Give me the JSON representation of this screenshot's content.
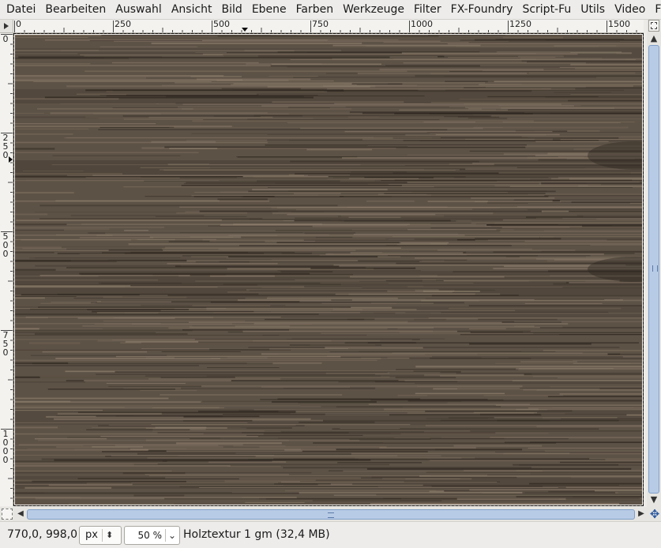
{
  "menu": {
    "items": [
      {
        "label": "Datei"
      },
      {
        "label": "Bearbeiten"
      },
      {
        "label": "Auswahl"
      },
      {
        "label": "Ansicht"
      },
      {
        "label": "Bild"
      },
      {
        "label": "Ebene"
      },
      {
        "label": "Farben"
      },
      {
        "label": "Werkzeuge"
      },
      {
        "label": "Filter"
      },
      {
        "label": "FX-Foundry"
      },
      {
        "label": "Script-Fu"
      },
      {
        "label": "Utils"
      },
      {
        "label": "Video"
      },
      {
        "label": "Fenster"
      }
    ]
  },
  "rulers": {
    "horizontal_labels": [
      "0",
      "250",
      "500",
      "750",
      "1000",
      "1250",
      "1500"
    ],
    "vertical_labels": [
      "0",
      "250",
      "500",
      "750",
      "1000"
    ]
  },
  "canvas": {
    "texture_base_color": "#5d5246",
    "texture_light_color": "#8c7d6c",
    "texture_dark_color": "#2f2821"
  },
  "statusbar": {
    "coords": "770,0, 998,0",
    "unit": "px",
    "zoom": "50 %",
    "image_info": "Holztextur 1 gm (32,4 MB)"
  },
  "icons": {
    "ruler_corner": "navigate-menu-icon",
    "zoom_fit": "zoom-follow-window-icon",
    "quick_mask": "quick-mask-icon",
    "navigate": "navigate-icon"
  },
  "colors": {
    "scroll_thumb": "#b8cbe6",
    "scroll_border": "#7f9fc8"
  }
}
